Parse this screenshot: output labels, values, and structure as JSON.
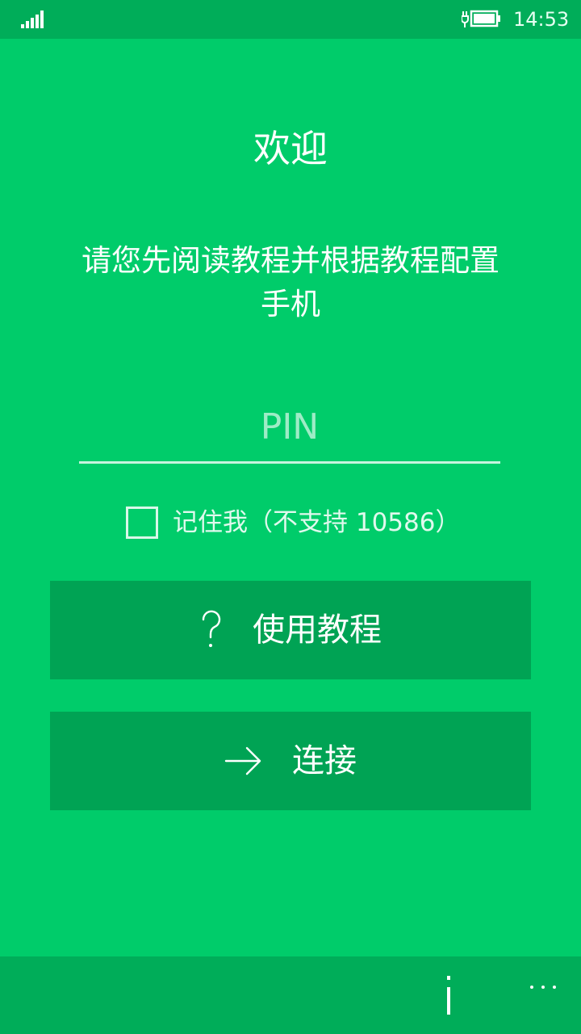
{
  "status_bar": {
    "time": "14:53",
    "signal_icon": "signal-bars-icon",
    "battery_icon": "battery-charging-icon"
  },
  "welcome": {
    "title": "欢迎",
    "instructions": "请您先阅读教程并根据教程配置手机"
  },
  "pin": {
    "placeholder": "PIN",
    "value": ""
  },
  "remember": {
    "label": "记住我（不支持 10586）",
    "checked": false
  },
  "buttons": {
    "tutorial": {
      "label": "使用教程",
      "icon": "question-mark-icon"
    },
    "connect": {
      "label": "连接",
      "icon": "arrow-right-icon"
    }
  },
  "app_bar": {
    "info_icon": "info-icon",
    "more_icon": "more-ellipsis-icon"
  },
  "colors": {
    "background": "#00cc6a",
    "bar": "#00ad59",
    "button": "#00a354"
  }
}
